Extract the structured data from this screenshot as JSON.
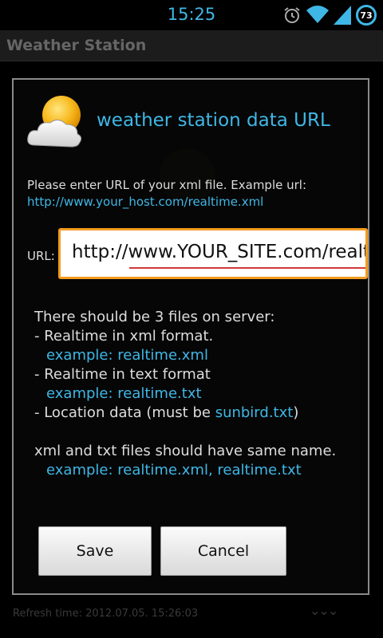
{
  "status_bar": {
    "time": "15:25",
    "battery": "73",
    "icons": [
      "alarm-icon",
      "wifi-icon",
      "signal-icon",
      "battery-icon"
    ]
  },
  "app": {
    "title": "Weather Station"
  },
  "background": {
    "refresh_text": "Refresh time: 2012.07.05. 15:26:03"
  },
  "dialog": {
    "title": "weather station data URL",
    "intro_line": "Please enter URL of your xml file. Example url:",
    "example_url": "http://www.your_host.com/realtime.xml",
    "url_label": "URL:",
    "url_value": "http://www.YOUR_SITE.com/realtime.xml",
    "info": {
      "heading": "There should be 3 files on server:",
      "item1": "- Realtime in xml format.",
      "item1_example": "example: realtime.xml",
      "item2": "- Realtime in text format",
      "item2_example": "example: realtime.txt",
      "item3_prefix": "- Location data (must be ",
      "item3_file": "sunbird.txt",
      "item3_suffix": ")",
      "same_name": "xml and txt files should have same name.",
      "same_name_example": "example: realtime.xml, realtime.txt"
    },
    "buttons": {
      "save": "Save",
      "cancel": "Cancel"
    }
  },
  "colors": {
    "accent": "#3fb7e6",
    "focus_border": "#f39c1f",
    "dialog_border": "#8a8a8a"
  }
}
